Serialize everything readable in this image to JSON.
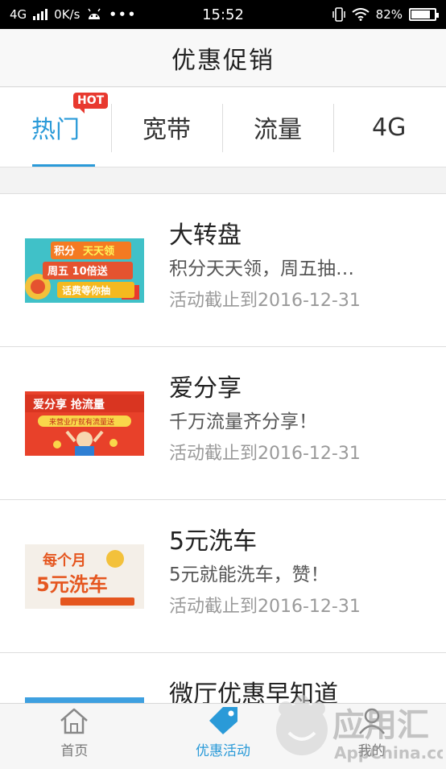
{
  "status_bar": {
    "network": "4G",
    "speed": "0K/s",
    "time": "15:52",
    "battery_percent": "82%",
    "battery_level": 0.82
  },
  "title": "优惠促销",
  "tabs": [
    {
      "label": "热门",
      "badge": "HOT",
      "active": true
    },
    {
      "label": "宽带",
      "active": false
    },
    {
      "label": "流量",
      "active": false
    },
    {
      "label": "4G",
      "active": false
    }
  ],
  "promotions": [
    {
      "title": "大转盘",
      "desc": "积分天天领，周五抽…",
      "date": "活动截止到2016-12-31",
      "thumb": {
        "line1a": "积分",
        "line1b": "天天领",
        "line2": "周五 10倍送",
        "line3": "话费等你抽"
      }
    },
    {
      "title": "爱分享",
      "desc": "千万流量齐分享！",
      "date": "活动截止到2016-12-31",
      "thumb": {
        "line1": "爱分享 抢流量",
        "line2": "来营业厅就有流量送"
      }
    },
    {
      "title": "5元洗车",
      "desc": "5元就能洗车，赞！",
      "date": "活动截止到2016-12-31",
      "thumb": {
        "line1": "每个月",
        "line2": "5元洗车"
      }
    },
    {
      "title": "微厅优惠早知道",
      "desc": "",
      "date": ""
    }
  ],
  "bottom_nav": [
    {
      "label": "首页",
      "icon": "home-icon",
      "active": false
    },
    {
      "label": "优惠活动",
      "icon": "tag-icon",
      "active": true
    },
    {
      "label": "我的",
      "icon": "user-icon",
      "active": false
    }
  ],
  "watermark": {
    "brand": "应用汇",
    "site": "AppChina.com"
  },
  "colors": {
    "accent": "#2a9ad8",
    "hot_badge": "#e8392f"
  }
}
